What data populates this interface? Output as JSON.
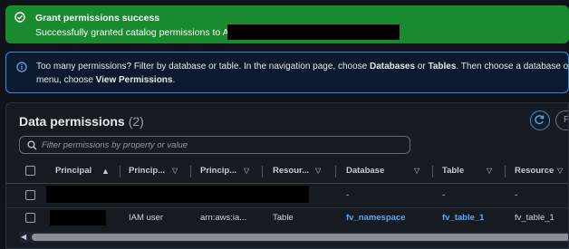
{
  "flash": {
    "title": "Grant permissions success",
    "message": "Successfully granted catalog permissions to ARNs:"
  },
  "info": {
    "line1_a": "Too many permissions? Filter by database or table. In the navigation page, choose ",
    "line1_b": "Databases",
    "line1_c": " or ",
    "line1_d": "Tables",
    "line1_e": ". Then choose a database or table, and",
    "line2_a": "menu, choose ",
    "line2_b": "View Permissions",
    "line2_c": "."
  },
  "panel": {
    "title": "Data permissions",
    "count": "(2)",
    "search_placeholder": "Filter permissions by property or value",
    "second_button_label": "F"
  },
  "table": {
    "columns": [
      "Principal",
      "Princip...",
      "Princip...",
      "Resour...",
      "Database",
      "Table",
      "Resource"
    ],
    "sort_indicator": "▲",
    "rows": [
      [
        "",
        "",
        "",
        "",
        "-",
        "-",
        "-"
      ],
      [
        "",
        "IAM user",
        "arn:aws:ia...",
        "Table",
        "fv_namespace",
        "fv_table_1",
        "fv_table_1"
      ]
    ]
  },
  "colors": {
    "success": "#1a8a2f",
    "info_border": "#3d8bd9",
    "link": "#5aa9f0"
  }
}
